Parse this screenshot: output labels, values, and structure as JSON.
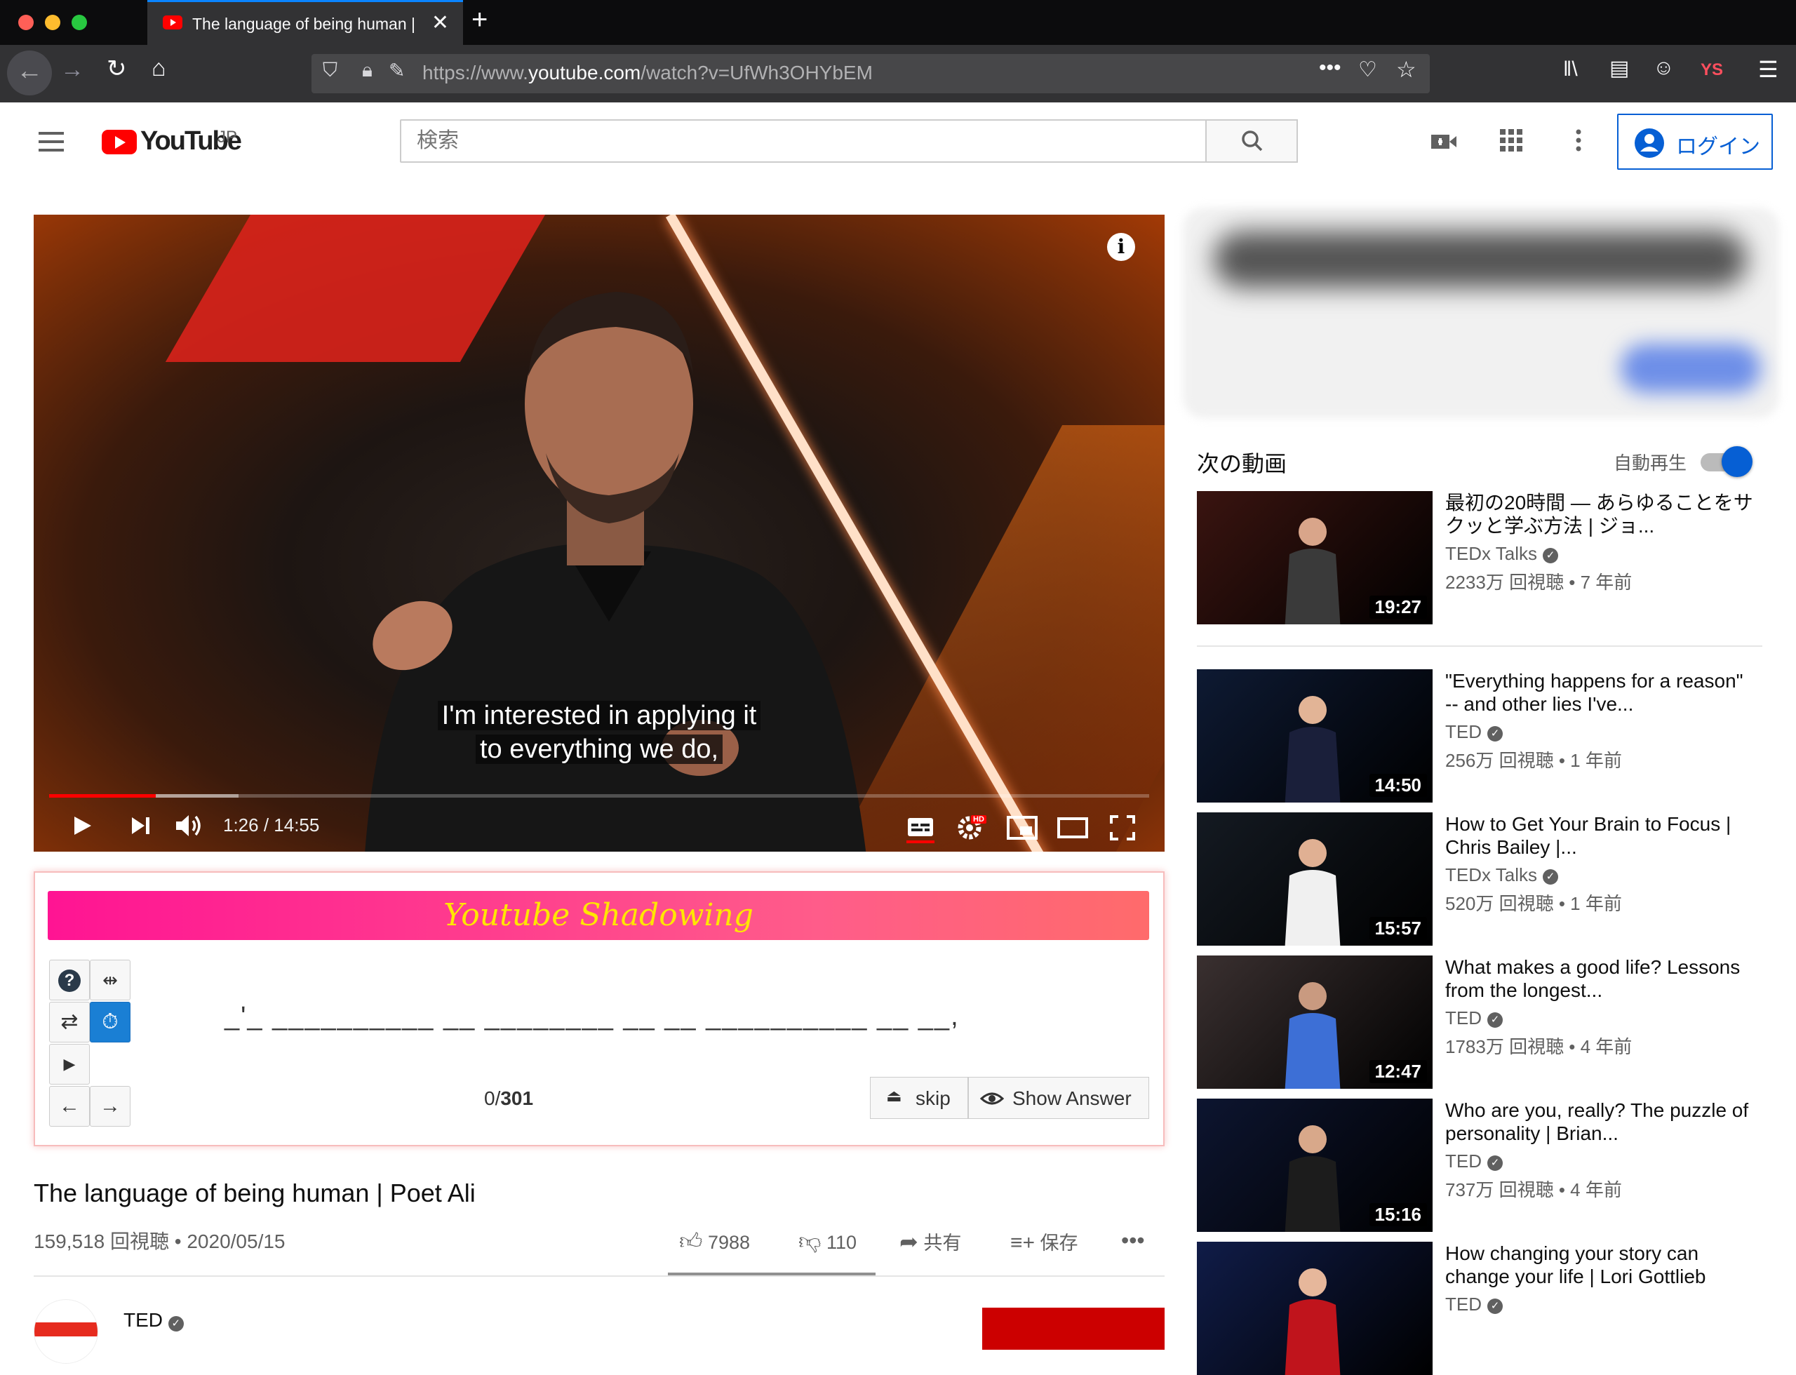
{
  "browser": {
    "tab_title": "The language of being human |",
    "new_tab_symbol": "+",
    "url_prefix": "https://www.",
    "url_domain": "youtube.com",
    "url_path": "/watch?v=UfWh3OHYbEM",
    "toolbar_profile": "YS",
    "traffic_light_colors": [
      "#ff5f57",
      "#febc2e",
      "#28c840"
    ]
  },
  "youtube_header": {
    "logo_text": "YouTube",
    "region": "JP",
    "search_placeholder": "検索",
    "login_label": "ログイン",
    "accent": "#065fd4"
  },
  "player": {
    "subtitle_line1": "I'm interested in applying it",
    "subtitle_line2": "to everything we do,",
    "time_display": "1:26 / 14:55",
    "played_fraction": 0.097,
    "buffered_fraction": 0.172,
    "controls": [
      "play-icon",
      "next-icon",
      "volume-icon",
      "captions-icon",
      "settings-icon",
      "miniplayer-icon",
      "theater-icon",
      "fullscreen-icon"
    ],
    "hd_badge": "HD"
  },
  "shadowing": {
    "title": "Youtube Shadowing",
    "blanks": "_'_ __________ __ ________ __ __ __________ __ __,",
    "progress_current": "0/",
    "progress_total": "301",
    "skip_label": "skip",
    "show_answer_label": "Show Answer"
  },
  "video": {
    "title": "The language of being human | Poet Ali",
    "meta": "159,518 回視聴 • 2020/05/15",
    "likes": "7988",
    "dislikes": "110",
    "share_label": "共有",
    "save_label": "保存",
    "channel": "TED"
  },
  "sidebar": {
    "up_next_label": "次の動画",
    "autoplay_label": "自動再生",
    "autoplay_on": true,
    "recommendations": [
      {
        "title": "最初の20時間 — あらゆることをサクッと学ぶ方法 | ジョ...",
        "channel": "TEDx Talks",
        "meta": "2233万 回視聴 • 7 年前",
        "duration": "19:27",
        "bg": "#3a1410"
      },
      {
        "title": "\"Everything happens for a reason\" -- and other lies I've...",
        "channel": "TED",
        "meta": "256万 回視聴 • 1 年前",
        "duration": "14:50",
        "bg": "#0e1a33"
      },
      {
        "title": "How to Get Your Brain to Focus | Chris Bailey |...",
        "channel": "TEDx Talks",
        "meta": "520万 回視聴 • 1 年前",
        "duration": "15:57",
        "bg": "#141a22"
      },
      {
        "title": "What makes a good life? Lessons from the longest...",
        "channel": "TED",
        "meta": "1783万 回視聴 • 4 年前",
        "duration": "12:47",
        "bg": "#3a3030"
      },
      {
        "title": "Who are you, really? The puzzle of personality | Brian...",
        "channel": "TED",
        "meta": "737万 回視聴 • 4 年前",
        "duration": "15:16",
        "bg": "#0d1530"
      },
      {
        "title": "How changing your story can change your life | Lori Gottlieb",
        "channel": "TED",
        "meta": "",
        "duration": "",
        "bg": "#101c48"
      }
    ]
  }
}
